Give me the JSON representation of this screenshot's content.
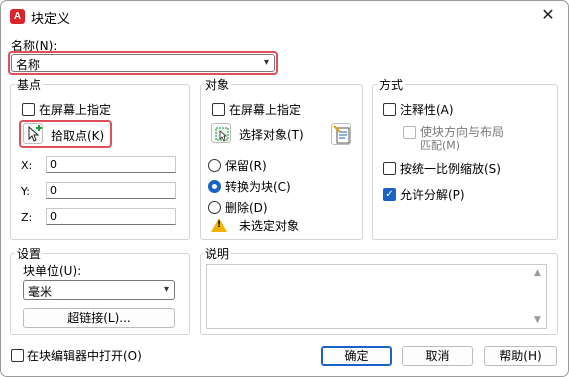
{
  "window": {
    "title": "块定义",
    "app_icon_letter": "A",
    "close_glyph": "✕"
  },
  "name": {
    "label": "名称(N):",
    "value": "名称"
  },
  "base_point": {
    "title": "基点",
    "specify_on_screen": "在屏幕上指定",
    "pick_point": "拾取点(K)",
    "x_label": "X:",
    "x_value": "0",
    "y_label": "Y:",
    "y_value": "0",
    "z_label": "Z:",
    "z_value": "0"
  },
  "objects": {
    "title": "对象",
    "specify_on_screen": "在屏幕上指定",
    "select_objects": "选择对象(T)",
    "retain": "保留(R)",
    "convert_to_block": "转换为块(C)",
    "delete": "删除(D)",
    "warning": "未选定对象",
    "selected_option": "convert_to_block"
  },
  "behavior": {
    "title": "方式",
    "annotative": "注释性(A)",
    "match_orientation_line1": "使块方向与布局",
    "match_orientation_line2": "匹配(M)",
    "scale_uniformly": "按统一比例缩放(S)",
    "allow_exploding": "允许分解(P)",
    "allow_exploding_checked": true
  },
  "settings": {
    "title": "设置",
    "block_unit_label": "块单位(U):",
    "block_unit_value": "毫米",
    "hyperlink": "超链接(L)..."
  },
  "description": {
    "title": "说明",
    "value": ""
  },
  "footer": {
    "open_in_editor": "在块编辑器中打开(O)",
    "ok": "确定",
    "cancel": "取消",
    "help": "帮助(H)"
  },
  "icons": {
    "dropdown": "▾",
    "scroll_up": "▲",
    "scroll_down": "▼",
    "check": "✓"
  },
  "colors": {
    "accent": "#1a62c6",
    "highlight_box": "#e0505a",
    "warning": "#f0b400",
    "app_icon": "#d9242b"
  }
}
